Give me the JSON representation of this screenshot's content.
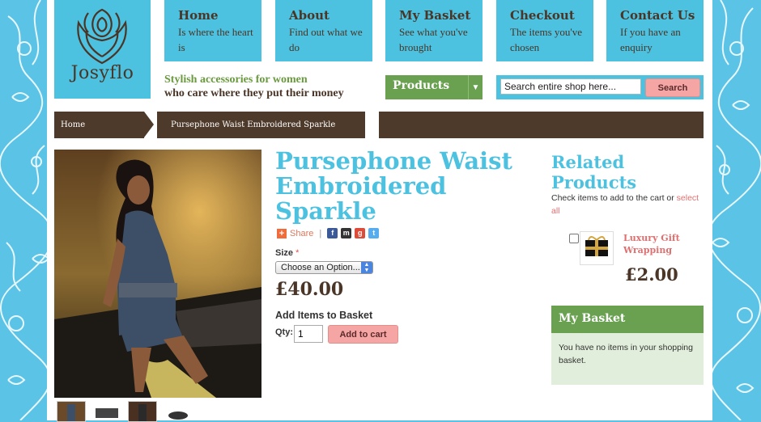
{
  "brand": {
    "logo_text": "Josyflo"
  },
  "nav": [
    {
      "title": "Home",
      "sub": "Is where the heart is"
    },
    {
      "title": "About",
      "sub": "Find out what we do"
    },
    {
      "title": "My Basket",
      "sub": "See what you've brought"
    },
    {
      "title": "Checkout",
      "sub": "The items you've chosen"
    },
    {
      "title": "Contact Us",
      "sub": "If you have an enquiry"
    }
  ],
  "tagline": {
    "line1": "Stylish accessories for women",
    "line2": "who care where they put their money"
  },
  "products_menu": {
    "label": "Products"
  },
  "search": {
    "value": "Search entire shop here...",
    "button": "Search"
  },
  "breadcrumb": {
    "home": "Home",
    "current": "Pursephone Waist Embroidered Sparkle"
  },
  "product": {
    "title": "Pursephone Waist Embroidered Sparkle",
    "share_label": "Share",
    "size_label": "Size",
    "required_mark": "*",
    "size_selected": "Choose an Option...",
    "price": "£40.00",
    "add_heading": "Add Items to Basket",
    "qty_label": "Qty:",
    "qty_value": "1",
    "add_button": "Add to cart"
  },
  "related": {
    "title": "Related Products",
    "hint": "Check items to add to the cart or",
    "select_all": "select all",
    "items": [
      {
        "name": "Luxury Gift Wrapping",
        "price": "£2.00"
      }
    ]
  },
  "basket": {
    "title": "My Basket",
    "empty_text": "You have no items in your shopping basket."
  },
  "colors": {
    "accent_blue": "#4cc2e0",
    "accent_green": "#6aa151",
    "brown": "#4e3a2a",
    "pink_button": "#f5a6a4"
  }
}
